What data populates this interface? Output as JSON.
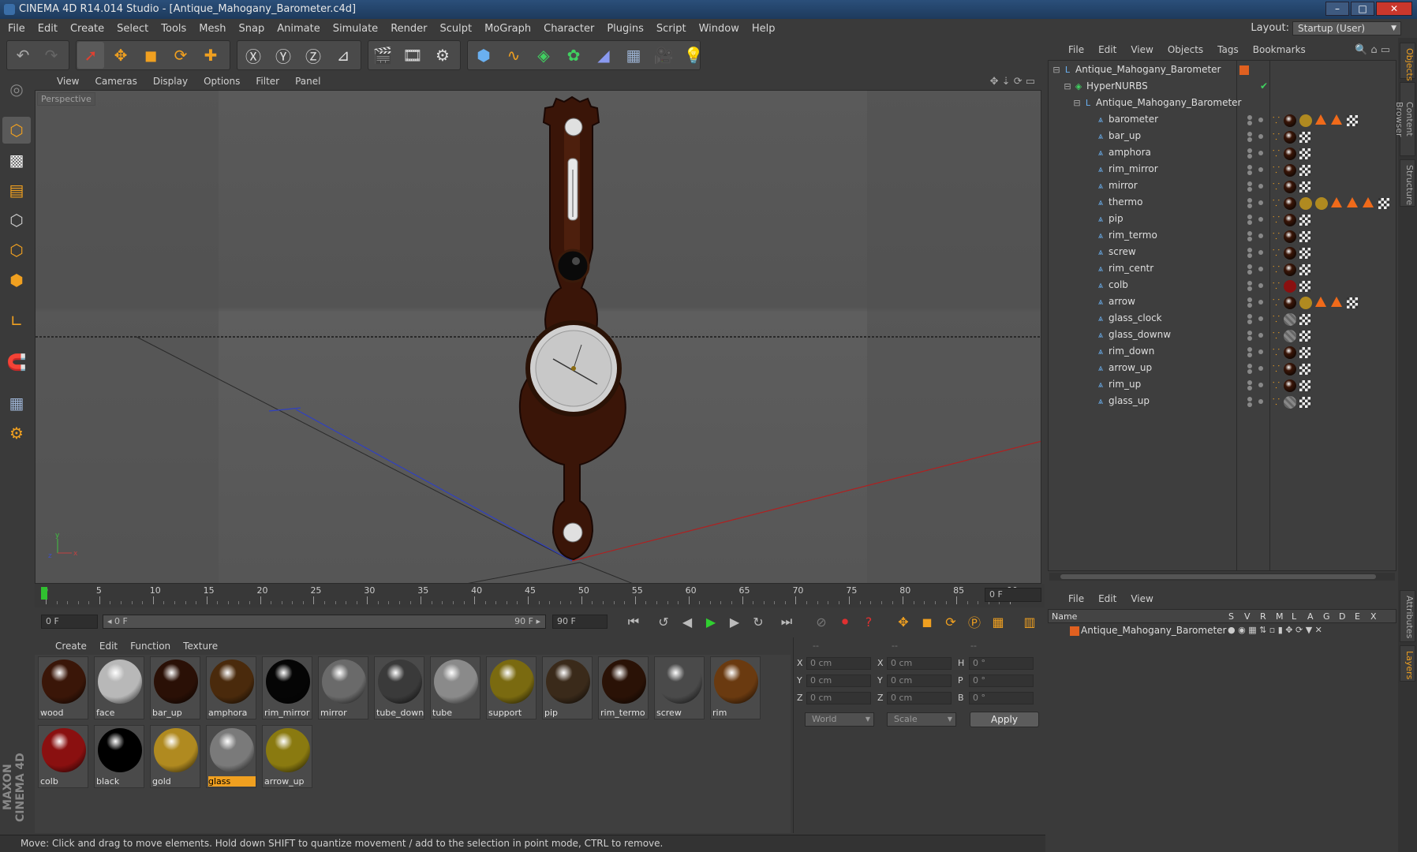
{
  "window": {
    "title": "CINEMA 4D R14.014 Studio - [Antique_Mahogany_Barometer.c4d]",
    "minimize": "–",
    "maximize": "□",
    "close": "✕"
  },
  "menubar": {
    "items": [
      "File",
      "Edit",
      "Create",
      "Select",
      "Tools",
      "Mesh",
      "Snap",
      "Animate",
      "Simulate",
      "Render",
      "Sculpt",
      "MoGraph",
      "Character",
      "Plugins",
      "Script",
      "Window",
      "Help"
    ],
    "layout_label": "Layout:",
    "layout_value": "Startup (User)"
  },
  "viewport": {
    "menu": [
      "View",
      "Cameras",
      "Display",
      "Options",
      "Filter",
      "Panel"
    ],
    "label": "Perspective"
  },
  "timeline": {
    "ticks": [
      "0",
      "5",
      "10",
      "15",
      "20",
      "25",
      "30",
      "35",
      "40",
      "45",
      "50",
      "55",
      "60",
      "65",
      "70",
      "75",
      "80",
      "85",
      "90"
    ],
    "current_frame": "0 F",
    "start_field": "0 F",
    "range_start": "◂ 0 F",
    "range_end": "90 F ▸",
    "end_field": "90 F"
  },
  "materials": {
    "menu": [
      "Create",
      "Edit",
      "Function",
      "Texture"
    ],
    "items": [
      {
        "name": "wood",
        "color": "#3a1608"
      },
      {
        "name": "face",
        "color": "#b8b8b8"
      },
      {
        "name": "bar_up",
        "color": "#2a1006"
      },
      {
        "name": "amphora",
        "color": "#4a2a0c"
      },
      {
        "name": "rim_mirror",
        "color": "#050505"
      },
      {
        "name": "mirror",
        "color": "#6a6a6a"
      },
      {
        "name": "tube_down",
        "color": "#3a3a3a"
      },
      {
        "name": "tube",
        "color": "#8a8a8a"
      },
      {
        "name": "support",
        "color": "#7a6a10"
      },
      {
        "name": "pip",
        "color": "#3a2a1a"
      },
      {
        "name": "rim_termo",
        "color": "#2a1206"
      },
      {
        "name": "screw",
        "color": "#4a4a4a"
      },
      {
        "name": "rim",
        "color": "#6a3a10"
      },
      {
        "name": "colb",
        "color": "#8a1010"
      },
      {
        "name": "black",
        "color": "#000000"
      },
      {
        "name": "gold",
        "color": "#b08a20"
      },
      {
        "name": "glass",
        "color": "#7a7a7a"
      },
      {
        "name": "arrow_up",
        "color": "#8a7a10"
      }
    ],
    "selected": "glass"
  },
  "coords": {
    "header": [
      "--",
      "--",
      "--"
    ],
    "rows": [
      {
        "a": "X",
        "av": "0 cm",
        "b": "X",
        "bv": "0 cm",
        "c": "H",
        "cv": "0 °"
      },
      {
        "a": "Y",
        "av": "0 cm",
        "b": "Y",
        "bv": "0 cm",
        "c": "P",
        "cv": "0 °"
      },
      {
        "a": "Z",
        "av": "0 cm",
        "b": "Z",
        "bv": "0 cm",
        "c": "B",
        "cv": "0 °"
      }
    ],
    "world": "World",
    "scale": "Scale",
    "apply": "Apply"
  },
  "status": "Move: Click and drag to move elements. Hold down SHIFT to quantize movement / add to the selection in point mode, CTRL to remove.",
  "objects": {
    "menu": [
      "File",
      "Edit",
      "View",
      "Objects",
      "Tags",
      "Bookmarks"
    ],
    "root": "Antique_Mahogany_Barometer",
    "hypernurbs": "HyperNURBS",
    "group": "Antique_Mahogany_Barometer",
    "children": [
      "barometer",
      "bar_up",
      "amphora",
      "rim_mirror",
      "mirror",
      "thermo",
      "pip",
      "rim_termo",
      "screw",
      "rim_centr",
      "colb",
      "arrow",
      "glass_clock",
      "glass_downw",
      "rim_down",
      "arrow_up",
      "rim_up",
      "glass_up"
    ]
  },
  "layers": {
    "menu": [
      "File",
      "Edit",
      "View"
    ],
    "columns": {
      "name": "Name",
      "flags": [
        "S",
        "V",
        "R",
        "M",
        "L",
        "A",
        "G",
        "D",
        "E",
        "X"
      ]
    },
    "items": [
      "Antique_Mahogany_Barometer"
    ]
  },
  "maxon": "MAXON CINEMA 4D",
  "righttabs": [
    "Objects",
    "Content Browser",
    "Structure",
    "Attributes",
    "Layers"
  ]
}
